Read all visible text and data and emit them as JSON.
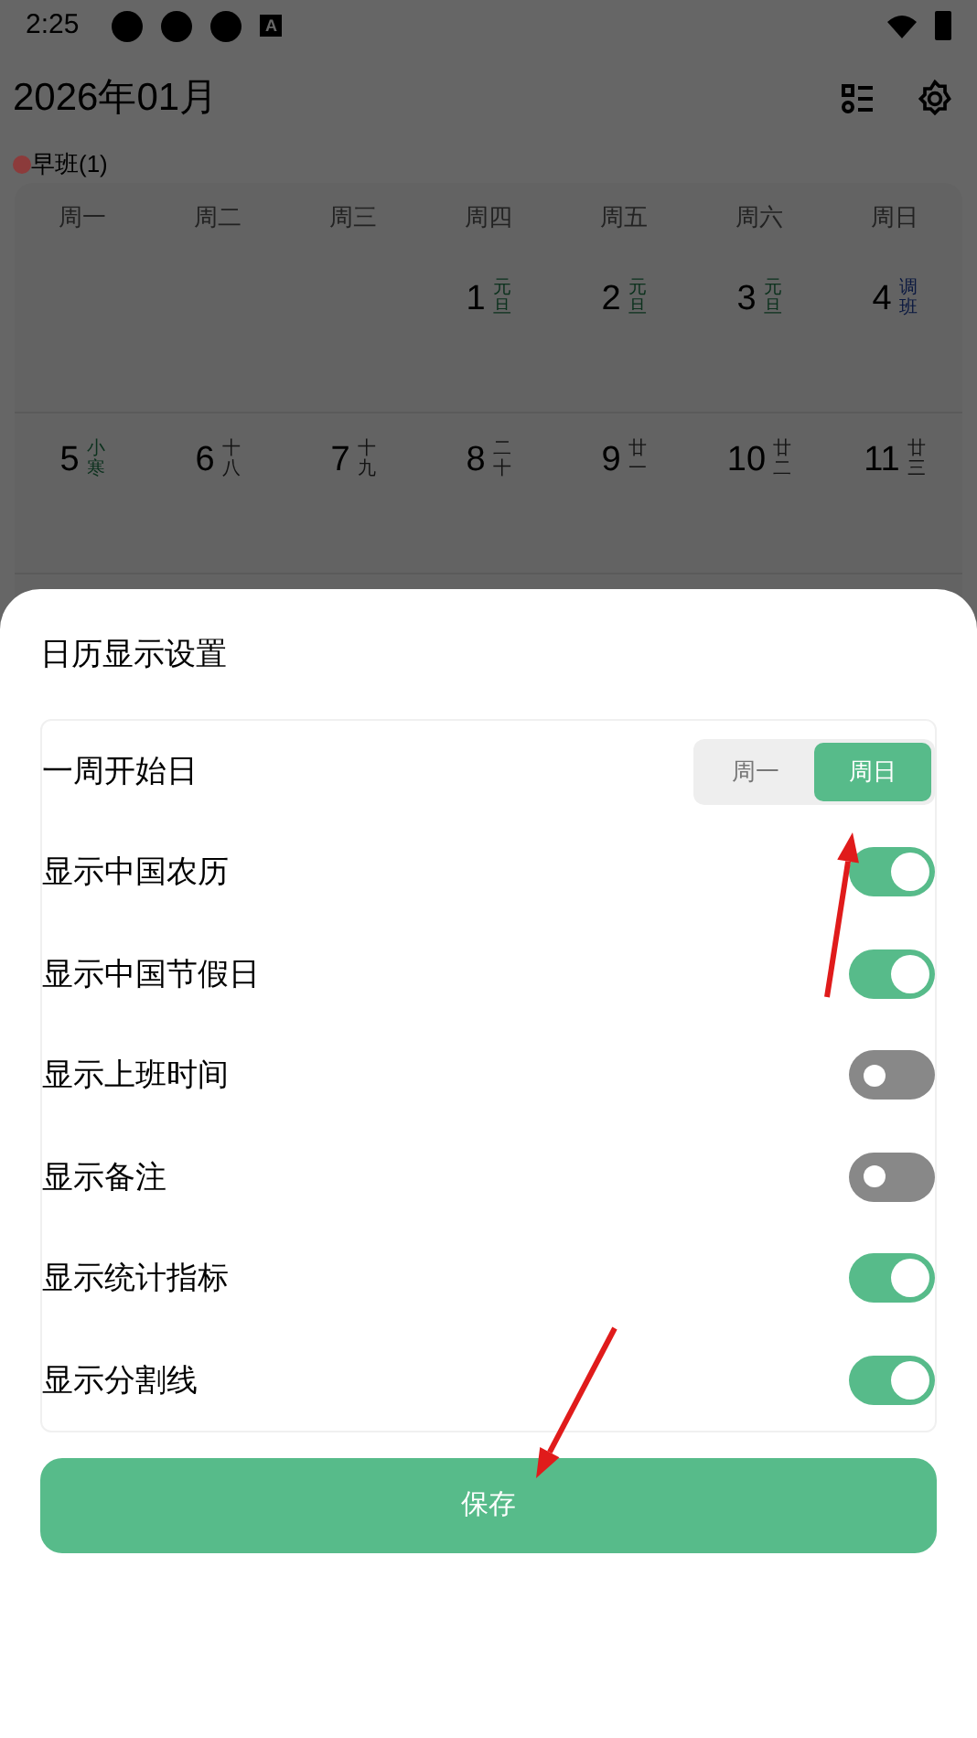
{
  "status_bar": {
    "time": "2:25",
    "notification_badge": "A"
  },
  "header": {
    "title": "2026年01月"
  },
  "legend": [
    {
      "label": "早班(1)",
      "color": "#8c3b3b"
    }
  ],
  "calendar": {
    "weekdays": [
      "周一",
      "周二",
      "周三",
      "周四",
      "周五",
      "周六",
      "周日"
    ],
    "weeks": [
      [
        {
          "kind": "empty"
        },
        {
          "kind": "empty"
        },
        {
          "kind": "empty"
        },
        {
          "day": "1",
          "note": "元旦",
          "kind": "holiday"
        },
        {
          "day": "2",
          "note": "元旦",
          "kind": "holiday"
        },
        {
          "day": "3",
          "note": "元旦",
          "kind": "holiday"
        },
        {
          "day": "4",
          "note": "调班",
          "kind": "workday"
        }
      ],
      [
        {
          "day": "5",
          "note": "小寒",
          "kind": "term"
        },
        {
          "day": "6",
          "note": "十八",
          "kind": "lunar"
        },
        {
          "day": "7",
          "note": "十九",
          "kind": "lunar"
        },
        {
          "day": "8",
          "note": "二十",
          "kind": "lunar"
        },
        {
          "day": "9",
          "note": "廿一",
          "kind": "lunar"
        },
        {
          "day": "10",
          "note": "廿二",
          "kind": "lunar"
        },
        {
          "day": "11",
          "note": "廿三",
          "kind": "lunar"
        }
      ]
    ]
  },
  "sheet": {
    "title": "日历显示设置",
    "week_start": {
      "label": "一周开始日",
      "options": [
        {
          "label": "周一",
          "selected": false
        },
        {
          "label": "周日",
          "selected": true
        }
      ]
    },
    "toggles": [
      {
        "label": "显示中国农历",
        "on": true
      },
      {
        "label": "显示中国节假日",
        "on": true
      },
      {
        "label": "显示上班时间",
        "on": false
      },
      {
        "label": "显示备注",
        "on": false
      },
      {
        "label": "显示统计指标",
        "on": true
      },
      {
        "label": "显示分割线",
        "on": true
      }
    ],
    "save_button": "保存"
  }
}
